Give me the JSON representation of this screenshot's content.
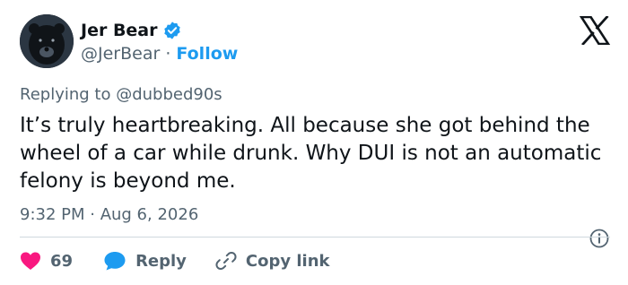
{
  "author": {
    "display_name": "Jer Bear",
    "handle": "@JerBear",
    "separator": " · ",
    "follow_label": "Follow"
  },
  "brand": {
    "logo": "x-logo-icon",
    "color": "#0f1419"
  },
  "reply_context": {
    "prefix": "Replying to ",
    "to": "@dubbed90s"
  },
  "tweet": {
    "text": "It’s truly heartbreaking. All because she got behind the wheel of a car while drunk. Why DUI is not an automatic felony is beyond me.",
    "timestamp": "9:32 PM · Aug 6, 2026"
  },
  "actions": {
    "like_count": "69",
    "reply_label": "Reply",
    "copy_link_label": "Copy link"
  },
  "colors": {
    "like": "#f91880",
    "reply": "#1d9bf0",
    "verified": "#1d9bf0",
    "secondary_text": "#536471",
    "follow": "#1d9bf0"
  }
}
